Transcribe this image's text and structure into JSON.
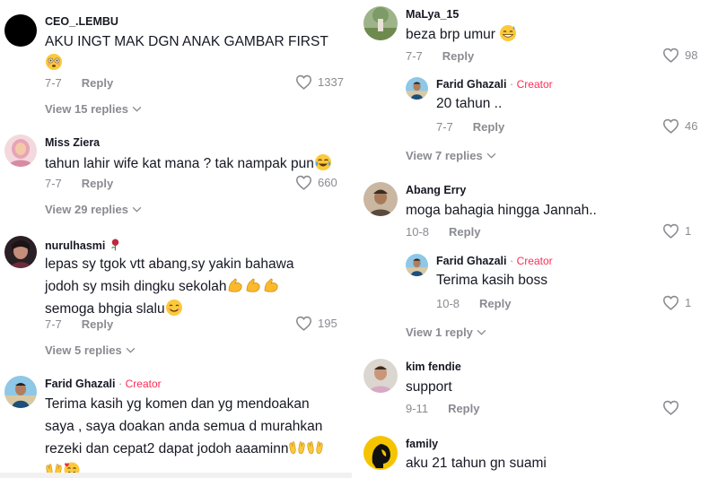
{
  "left_comments": [
    {
      "author": "CEO_.LEMBU",
      "text": "AKU INGT MAK DGN ANAK GAMBAR FIRST",
      "date": "7-7",
      "reply": "Reply",
      "likes": "1337",
      "view_replies": "View 15 replies",
      "emoji_after": "flushed"
    },
    {
      "author": "Miss Ziera",
      "text": "tahun lahir wife kat mana ? tak nampak pun",
      "date": "7-7",
      "reply": "Reply",
      "likes": "660",
      "view_replies": "View 29 replies",
      "emoji_after": "joy"
    },
    {
      "author": "nurulhasmi",
      "text_line1": "lepas sy tgok vtt abang,sy yakin bahawa",
      "text_line2": "jodoh sy msih dingku sekolah",
      "text_line3": "semoga bhgia slalu",
      "date": "7-7",
      "reply": "Reply",
      "likes": "195",
      "view_replies": "View 5 replies"
    },
    {
      "author": "Farid Ghazali",
      "creator": "Creator",
      "text_line1": "Terima kasih yg komen dan yg mendoakan",
      "text_line2": "saya , saya doakan anda semua d murahkan",
      "text_line3": "rezeki dan cepat2 dapat jodoh aaaminn"
    }
  ],
  "right_comments": [
    {
      "author": "MaLya_15",
      "text": "beza brp umur",
      "date": "7-7",
      "reply": "Reply",
      "likes": "98"
    },
    {
      "author": "Farid Ghazali",
      "creator": "Creator",
      "text": "20 tahun ..",
      "date": "7-7",
      "reply": "Reply",
      "likes": "46",
      "view_replies": "View 7 replies"
    },
    {
      "author": "Abang Erry",
      "text": "moga bahagia hingga Jannah..",
      "date": "10-8",
      "reply": "Reply",
      "likes": "1"
    },
    {
      "author": "Farid Ghazali",
      "creator": "Creator",
      "text": "Terima kasih boss",
      "date": "10-8",
      "reply": "Reply",
      "likes": "1",
      "view_replies": "View 1 reply"
    },
    {
      "author": "kim fendie",
      "text": "support",
      "date": "9-11",
      "reply": "Reply"
    },
    {
      "author": "family",
      "text": "aku 21 tahun gn suami"
    }
  ],
  "colors": {
    "creator": "#fe2c55",
    "muted": "#8a8b91",
    "text": "#161823"
  }
}
